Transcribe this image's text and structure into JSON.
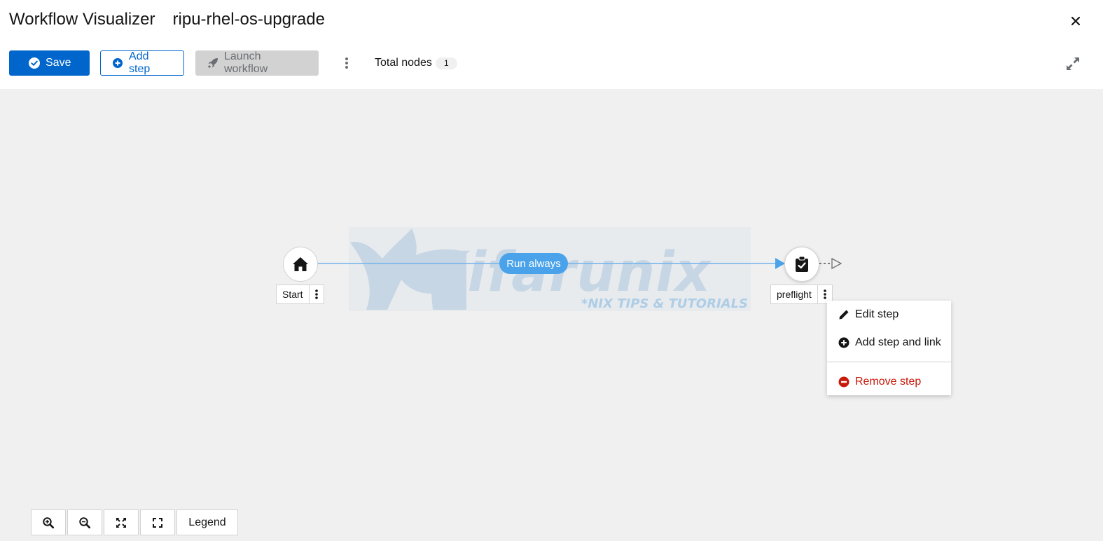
{
  "header": {
    "title": "Workflow Visualizer",
    "workflow_name": "ripu-rhel-os-upgrade"
  },
  "toolbar": {
    "save_label": "Save",
    "add_step_label": "Add step",
    "launch_label": "Launch workflow",
    "total_nodes_label": "Total nodes",
    "total_nodes_count": "1"
  },
  "graph": {
    "start_label": "Start",
    "link_label": "Run always",
    "node_label": "preflight"
  },
  "watermark": {
    "brand": "Kifarunix",
    "tagline": "*NIX TIPS & TUTORIALS"
  },
  "context_menu": {
    "items": [
      {
        "label": "Edit step",
        "icon": "pencil-icon"
      },
      {
        "label": "Add step and link",
        "icon": "plus-circle-icon"
      },
      {
        "label": "Remove step",
        "icon": "minus-circle-icon"
      }
    ]
  },
  "zoom_controls": {
    "legend_label": "Legend"
  },
  "colors": {
    "primary": "#0066cc",
    "link": "#4aa3ea",
    "danger": "#c9190b",
    "canvas": "#f0f0f0"
  }
}
